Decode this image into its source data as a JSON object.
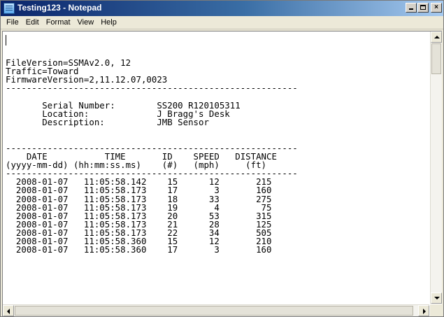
{
  "window": {
    "title": "Testing123 - Notepad",
    "controls": {
      "minimize": "_",
      "close": "×"
    }
  },
  "menu": [
    "File",
    "Edit",
    "Format",
    "View",
    "Help"
  ],
  "document": {
    "lines": [
      "FileVersion=SSMAv2.0, 12",
      "Traffic=Toward",
      "FirmwareVersion=2,11.12.07,0023",
      "--------------------------------------------------------",
      "",
      "       Serial Number:        SS200 R120105311",
      "       Location:             J Bragg's Desk",
      "       Description:          JMB Sensor",
      "",
      "",
      "--------------------------------------------------------",
      "    DATE           TIME       ID    SPEED   DISTANCE",
      "(yyyy-mm-dd) (hh:mm:ss.ms)    (#)   (mph)     (ft)",
      "--------------------------------------------------------",
      "  2008-01-07   11:05:58.142    15      12       215",
      "  2008-01-07   11:05:58.173    17       3       160",
      "  2008-01-07   11:05:58.173    18      33       275",
      "  2008-01-07   11:05:58.173    19       4        75",
      "  2008-01-07   11:05:58.173    20      53       315",
      "  2008-01-07   11:05:58.173    21      28       125",
      "  2008-01-07   11:05:58.173    22      34       505",
      "  2008-01-07   11:05:58.360    15      12       210",
      "  2008-01-07   11:05:58.360    17       3       160"
    ]
  }
}
